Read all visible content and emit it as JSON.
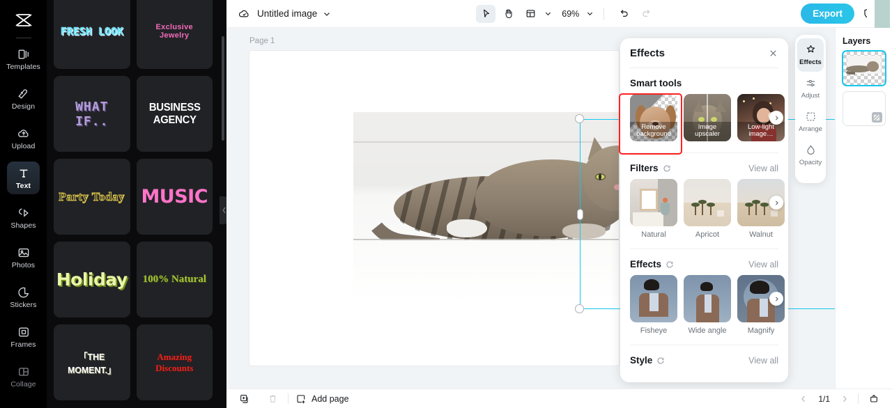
{
  "app": {
    "left_rail": {
      "logo_icon": "capcut-logo-icon",
      "items": [
        {
          "label": "Templates",
          "icon": "templates-icon",
          "active": false
        },
        {
          "label": "Design",
          "icon": "design-icon",
          "active": false
        },
        {
          "label": "Upload",
          "icon": "upload-cloud-icon",
          "active": false
        },
        {
          "label": "Text",
          "icon": "text-icon",
          "active": true
        },
        {
          "label": "Shapes",
          "icon": "shapes-icon",
          "active": false
        },
        {
          "label": "Photos",
          "icon": "photos-icon",
          "active": false
        },
        {
          "label": "Stickers",
          "icon": "stickers-icon",
          "active": false
        },
        {
          "label": "Frames",
          "icon": "frames-icon",
          "active": false
        },
        {
          "label": "Collage",
          "icon": "collage-icon",
          "active": false
        }
      ]
    },
    "templates_panel": {
      "cards": [
        {
          "text": "FRESH LOOK",
          "style": "t-fresh"
        },
        {
          "text": "Exclusive Jewelry",
          "style": "t-jewelry"
        },
        {
          "text": "WHAT IF..",
          "style": "t-whatif"
        },
        {
          "text": "BUSINESS AGENCY",
          "style": "t-biz"
        },
        {
          "text": "Party Today",
          "style": "t-party"
        },
        {
          "text": "MUSIC",
          "style": "t-music"
        },
        {
          "text": "Holiday",
          "style": "t-holiday"
        },
        {
          "text": "100% Natural",
          "style": "t-natural"
        },
        {
          "text": "「THE MOMENT.」",
          "style": "t-moment"
        },
        {
          "text": "Amazing Discounts",
          "style": "t-discount"
        }
      ]
    },
    "topbar": {
      "cloud_icon": "cloud-saved-icon",
      "doc_title": "Untitled image",
      "title_chevron_icon": "chevron-down-icon",
      "select_tool_icon": "cursor-select-icon",
      "hand_tool_icon": "hand-pan-icon",
      "layout_tool_icon": "layout-grid-icon",
      "layout_chevron_icon": "chevron-down-icon",
      "zoom_level": "69%",
      "zoom_chevron_icon": "chevron-down-icon",
      "undo_icon": "undo-icon",
      "redo_icon": "redo-icon",
      "export_label": "Export",
      "shield_icon": "shield-check-icon"
    },
    "canvas": {
      "page_label": "Page 1",
      "float_toolbar": [
        {
          "icon": "crop-icon",
          "name": "crop-button"
        },
        {
          "icon": "replace-icon",
          "name": "replace-button"
        },
        {
          "icon": "duplicate-icon",
          "name": "duplicate-button"
        },
        {
          "icon": "more-icon",
          "name": "more-options-button"
        }
      ],
      "rotate_icon": "rotate-handle-icon",
      "selection_color": "#15c7f0"
    },
    "effects_panel": {
      "title": "Effects",
      "close_icon": "close-icon",
      "sections": [
        {
          "title": "Smart tools",
          "has_refresh": false,
          "view_all": null,
          "caption_overlay": true,
          "items": [
            {
              "label": "Remove background",
              "art": "dog",
              "selected": true
            },
            {
              "label": "Image upscaler",
              "art": "cat",
              "selected": false
            },
            {
              "label": "Low-light image…",
              "art": "lowlight",
              "selected": false
            }
          ]
        },
        {
          "title": "Filters",
          "has_refresh": true,
          "view_all": "View all",
          "caption_overlay": false,
          "items": [
            {
              "label": "Natural",
              "art": "natural",
              "selected": false
            },
            {
              "label": "Apricot",
              "art": "desert",
              "selected": false
            },
            {
              "label": "Walnut",
              "art": "desert2",
              "selected": false
            }
          ]
        },
        {
          "title": "Effects",
          "has_refresh": true,
          "view_all": "View all",
          "caption_overlay": false,
          "items": [
            {
              "label": "Fisheye",
              "art": "man1",
              "selected": false
            },
            {
              "label": "Wide angle",
              "art": "man2",
              "selected": false
            },
            {
              "label": "Magnify",
              "art": "man3",
              "selected": false
            }
          ]
        },
        {
          "title": "Style",
          "has_refresh": true,
          "view_all": "View all",
          "caption_overlay": false,
          "items": []
        }
      ],
      "next_arrow_icon": "chevron-right-icon",
      "refresh_icon": "refresh-icon",
      "highlight_color": "#ff2020"
    },
    "effects_rail": {
      "items": [
        {
          "label": "Effects",
          "icon": "sparkle-effects-icon",
          "active": true
        },
        {
          "label": "Adjust",
          "icon": "sliders-adjust-icon",
          "active": false
        },
        {
          "label": "Arrange",
          "icon": "arrange-icon",
          "active": false
        },
        {
          "label": "Opacity",
          "icon": "opacity-drop-icon",
          "active": false
        }
      ]
    },
    "layers_panel": {
      "title": "Layers",
      "items": [
        {
          "name": "cat-image-layer",
          "selected": true,
          "badge_icon": null
        },
        {
          "name": "background-layer",
          "selected": false,
          "badge_icon": "transparent-badge-icon"
        }
      ]
    },
    "bottombar": {
      "duplicate_page_icon": "duplicate-page-icon",
      "delete_page_icon": "trash-icon",
      "add_page_icon": "add-page-icon",
      "add_page_label": "Add page",
      "prev_icon": "chevron-left-icon",
      "page_indicator": "1/1",
      "next_icon": "chevron-right-icon",
      "present_icon": "present-icon"
    }
  }
}
